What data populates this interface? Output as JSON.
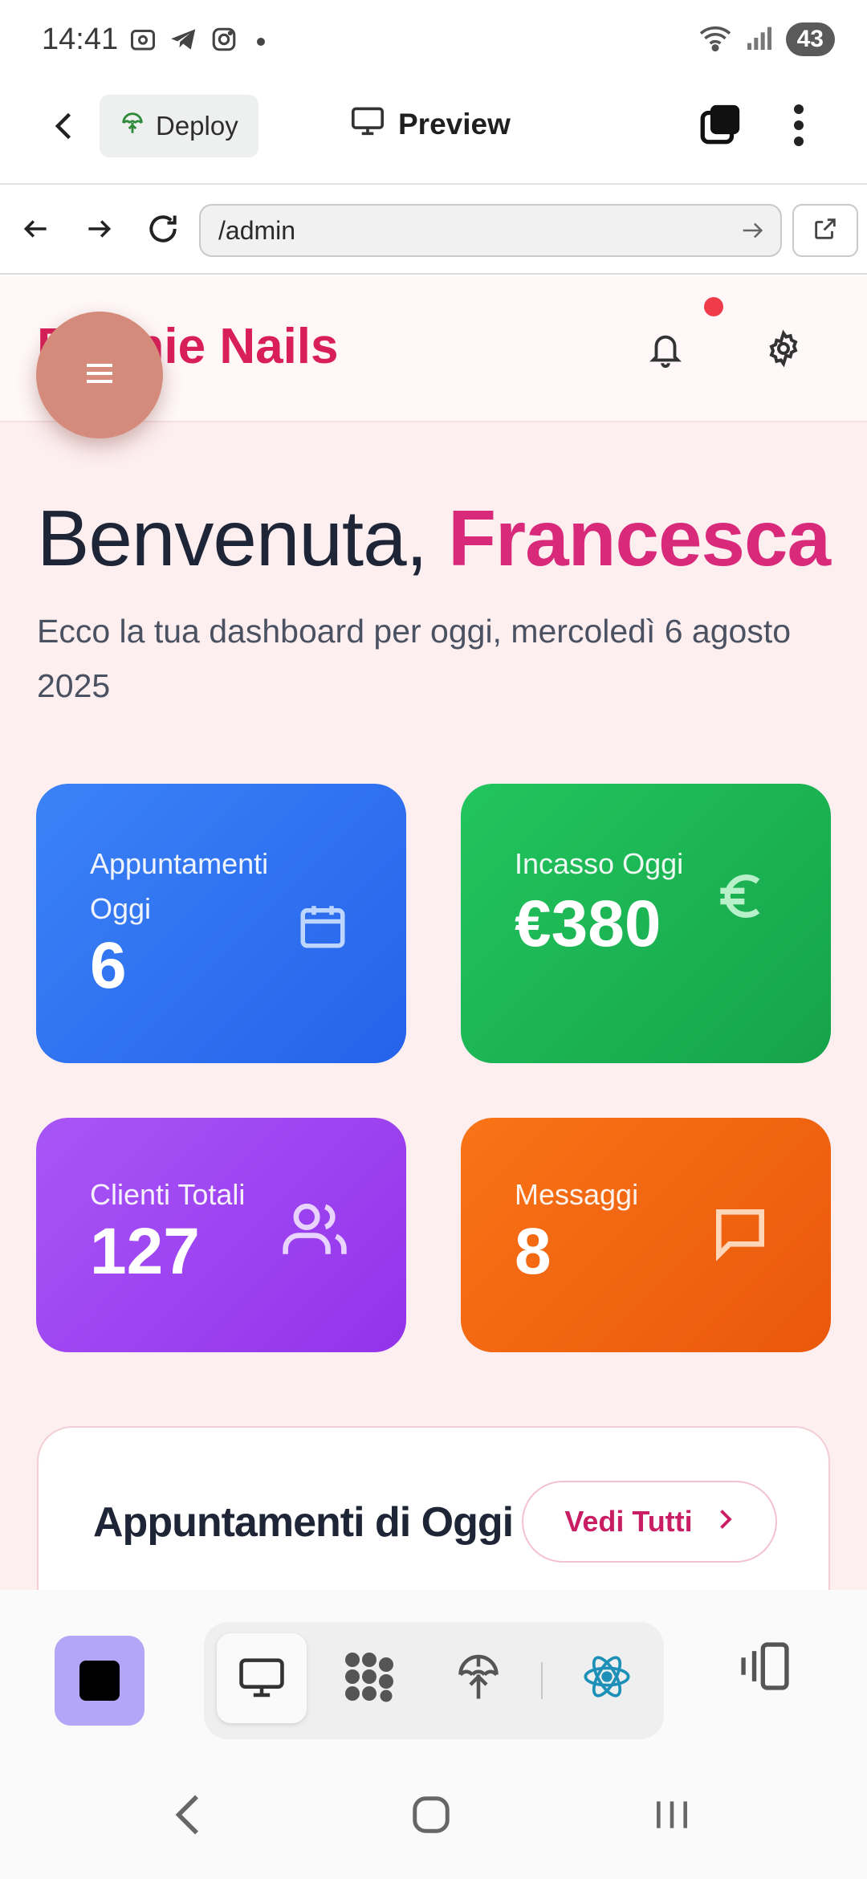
{
  "status_bar": {
    "time": "14:41",
    "battery": "43"
  },
  "app_bar": {
    "deploy_label": "Deploy",
    "preview_label": "Preview"
  },
  "browser": {
    "url": "/admin"
  },
  "site": {
    "brand": "Bonnie Nails",
    "greeting_prefix": "Benvenuta, ",
    "greeting_name": "Francesca",
    "subtitle": "Ecco la tua dashboard per oggi, mercoledì 6 agosto 2025",
    "stats": [
      {
        "label": "Appuntamenti Oggi",
        "value": "6",
        "icon": "calendar-icon",
        "color": "#3b82f6"
      },
      {
        "label": "Incasso Oggi",
        "value": "€380",
        "icon": "euro-icon",
        "color": "#22c55e"
      },
      {
        "label": "Clienti Totali",
        "value": "127",
        "icon": "users-icon",
        "color": "#a855f7"
      },
      {
        "label": "Messaggi",
        "value": "8",
        "icon": "message-icon",
        "color": "#f97316"
      }
    ],
    "appointments": {
      "title": "Appuntamenti di Oggi",
      "see_all": "Vedi Tutti"
    }
  },
  "colors": {
    "brand": "#d81e5b",
    "accent_name": "#d8297a",
    "fab": "#d58b7b",
    "stop_button": "#b3a5f7"
  }
}
